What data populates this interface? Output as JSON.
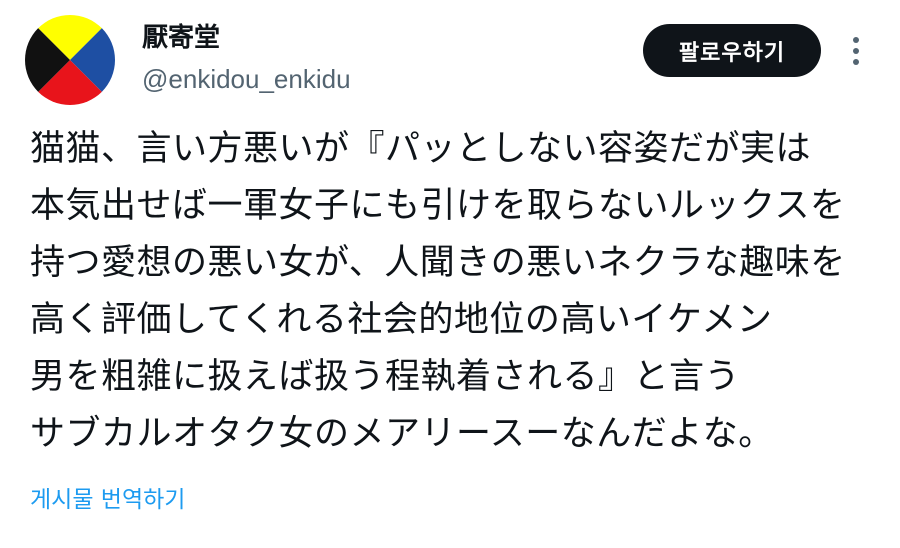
{
  "author": {
    "display_name": "厭寄堂",
    "handle": "@enkidou_enkidu",
    "avatar_icon": "quadrant-circle-avatar",
    "avatar_colors": {
      "top": "#ffff00",
      "right": "#1e4fa3",
      "bottom": "#e8141b",
      "left": "#111111"
    }
  },
  "actions": {
    "follow_label": "팔로우하기",
    "more_icon": "vertical-dots-icon"
  },
  "post": {
    "lines": [
      "猫猫、言い方悪いが『パッとしない容姿だが実は",
      "本気出せば一軍女子にも引けを取らないルックスを",
      "持つ愛想の悪い女が、人聞きの悪いネクラな趣味を",
      "高く評価してくれる社会的地位の高いイケメン",
      "男を粗雑に扱えば扱う程執着される』と言う",
      "サブカルオタク女のメアリースーなんだよな。"
    ]
  },
  "translate_label": "게시물 번역하기",
  "colors": {
    "text": "#0f1419",
    "secondary_text": "#536471",
    "link": "#1d9bf0",
    "button_bg": "#0f1419"
  }
}
